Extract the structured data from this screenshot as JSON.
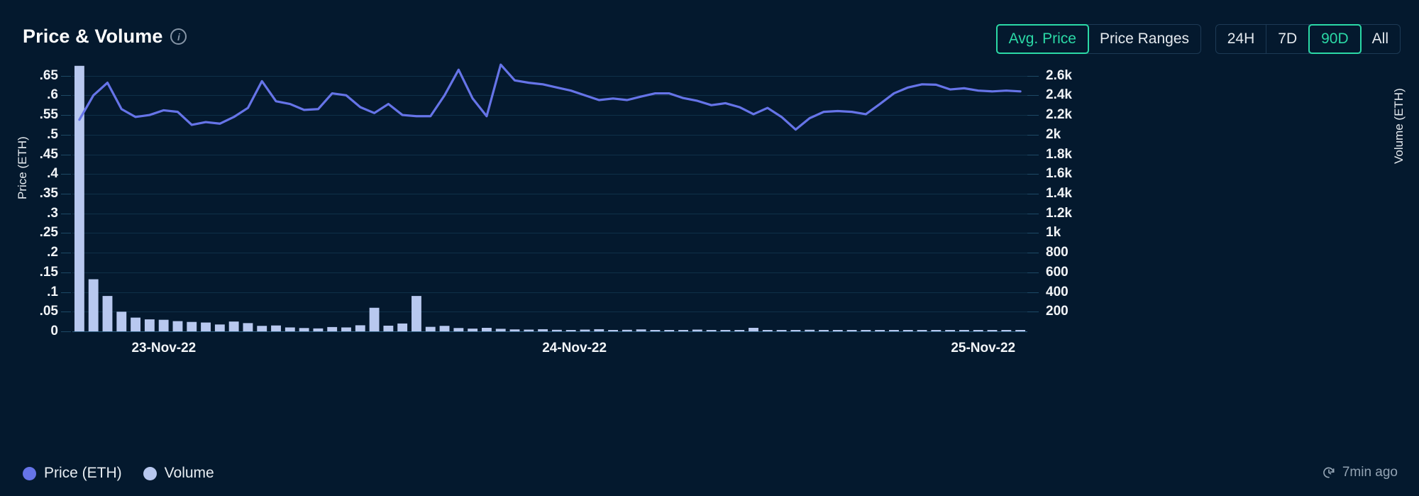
{
  "header": {
    "title": "Price & Volume",
    "info_icon": "info-icon",
    "mode_buttons": [
      {
        "label": "Avg. Price",
        "active": true
      },
      {
        "label": "Price Ranges",
        "active": false
      }
    ],
    "range_buttons": [
      {
        "label": "24H",
        "active": false
      },
      {
        "label": "7D",
        "active": false
      },
      {
        "label": "90D",
        "active": true
      },
      {
        "label": "All",
        "active": false
      }
    ]
  },
  "footer": {
    "legend": [
      {
        "label": "Price (ETH)",
        "color": "#6674e8"
      },
      {
        "label": "Volume",
        "color": "#b8c8ef"
      }
    ],
    "updated_text": "7min ago",
    "refresh_icon": "refresh-clock-icon"
  },
  "colors": {
    "background": "#04192e",
    "accent": "#2bd9a6",
    "price_line": "#6674e8",
    "volume_bar": "#b8c8ef",
    "grid": "#0f3048",
    "text": "#f2f5f8"
  },
  "chart_data": {
    "type": "line",
    "title": "Price & Volume",
    "xlabel": "",
    "ylabel": "Price (ETH)",
    "y2label": "Volume (ETH)",
    "ylim": [
      0,
      0.68
    ],
    "y2lim": [
      0,
      2720
    ],
    "grid": true,
    "legend_position": "bottom-left",
    "x_tick_labels": [
      "23-Nov-22",
      "24-Nov-22",
      "25-Nov-22"
    ],
    "x_tick_positions": [
      0.062,
      0.492,
      0.92
    ],
    "y_tick_labels": [
      ".65",
      ".6",
      ".55",
      ".5",
      ".45",
      ".4",
      ".35",
      ".3",
      ".25",
      ".2",
      ".15",
      ".1",
      ".05",
      "0"
    ],
    "y_tick_values": [
      0.65,
      0.6,
      0.55,
      0.5,
      0.45,
      0.4,
      0.35,
      0.3,
      0.25,
      0.2,
      0.15,
      0.1,
      0.05,
      0
    ],
    "y2_tick_labels": [
      "2.6k",
      "2.4k",
      "2.2k",
      "2k",
      "1.8k",
      "1.6k",
      "1.4k",
      "1.2k",
      "1k",
      "800",
      "600",
      "400",
      "200"
    ],
    "y2_tick_values": [
      2600,
      2400,
      2200,
      2000,
      1800,
      1600,
      1400,
      1200,
      1000,
      800,
      600,
      400,
      200
    ],
    "series": [
      {
        "name": "Price (ETH)",
        "type": "line",
        "axis": "left",
        "color": "#6674e8",
        "values": [
          0.538,
          0.6,
          0.632,
          0.565,
          0.545,
          0.55,
          0.562,
          0.558,
          0.525,
          0.532,
          0.528,
          0.545,
          0.568,
          0.636,
          0.585,
          0.578,
          0.563,
          0.565,
          0.605,
          0.6,
          0.57,
          0.555,
          0.578,
          0.55,
          0.547,
          0.547,
          0.6,
          0.665,
          0.592,
          0.547,
          0.678,
          0.638,
          0.632,
          0.628,
          0.62,
          0.612,
          0.6,
          0.588,
          0.592,
          0.588,
          0.597,
          0.605,
          0.605,
          0.593,
          0.586,
          0.575,
          0.58,
          0.57,
          0.552,
          0.568,
          0.545,
          0.513,
          0.542,
          0.558,
          0.56,
          0.558,
          0.552,
          0.578,
          0.605,
          0.62,
          0.628,
          0.627,
          0.615,
          0.618,
          0.612,
          0.61,
          0.612,
          0.61
        ]
      },
      {
        "name": "Volume",
        "type": "bar",
        "axis": "right",
        "color": "#b8c8ef",
        "values": [
          2700,
          530,
          360,
          200,
          140,
          122,
          118,
          104,
          96,
          90,
          70,
          100,
          84,
          56,
          60,
          40,
          34,
          30,
          44,
          40,
          62,
          240,
          58,
          80,
          360,
          46,
          56,
          34,
          28,
          36,
          26,
          20,
          18,
          22,
          16,
          14,
          18,
          22,
          12,
          16,
          20,
          14,
          12,
          10,
          18,
          14,
          10,
          12,
          36,
          14,
          10,
          12,
          16,
          10,
          8,
          12,
          14,
          10,
          12,
          8,
          14,
          10,
          8,
          12,
          10,
          8,
          12,
          6
        ]
      }
    ]
  }
}
